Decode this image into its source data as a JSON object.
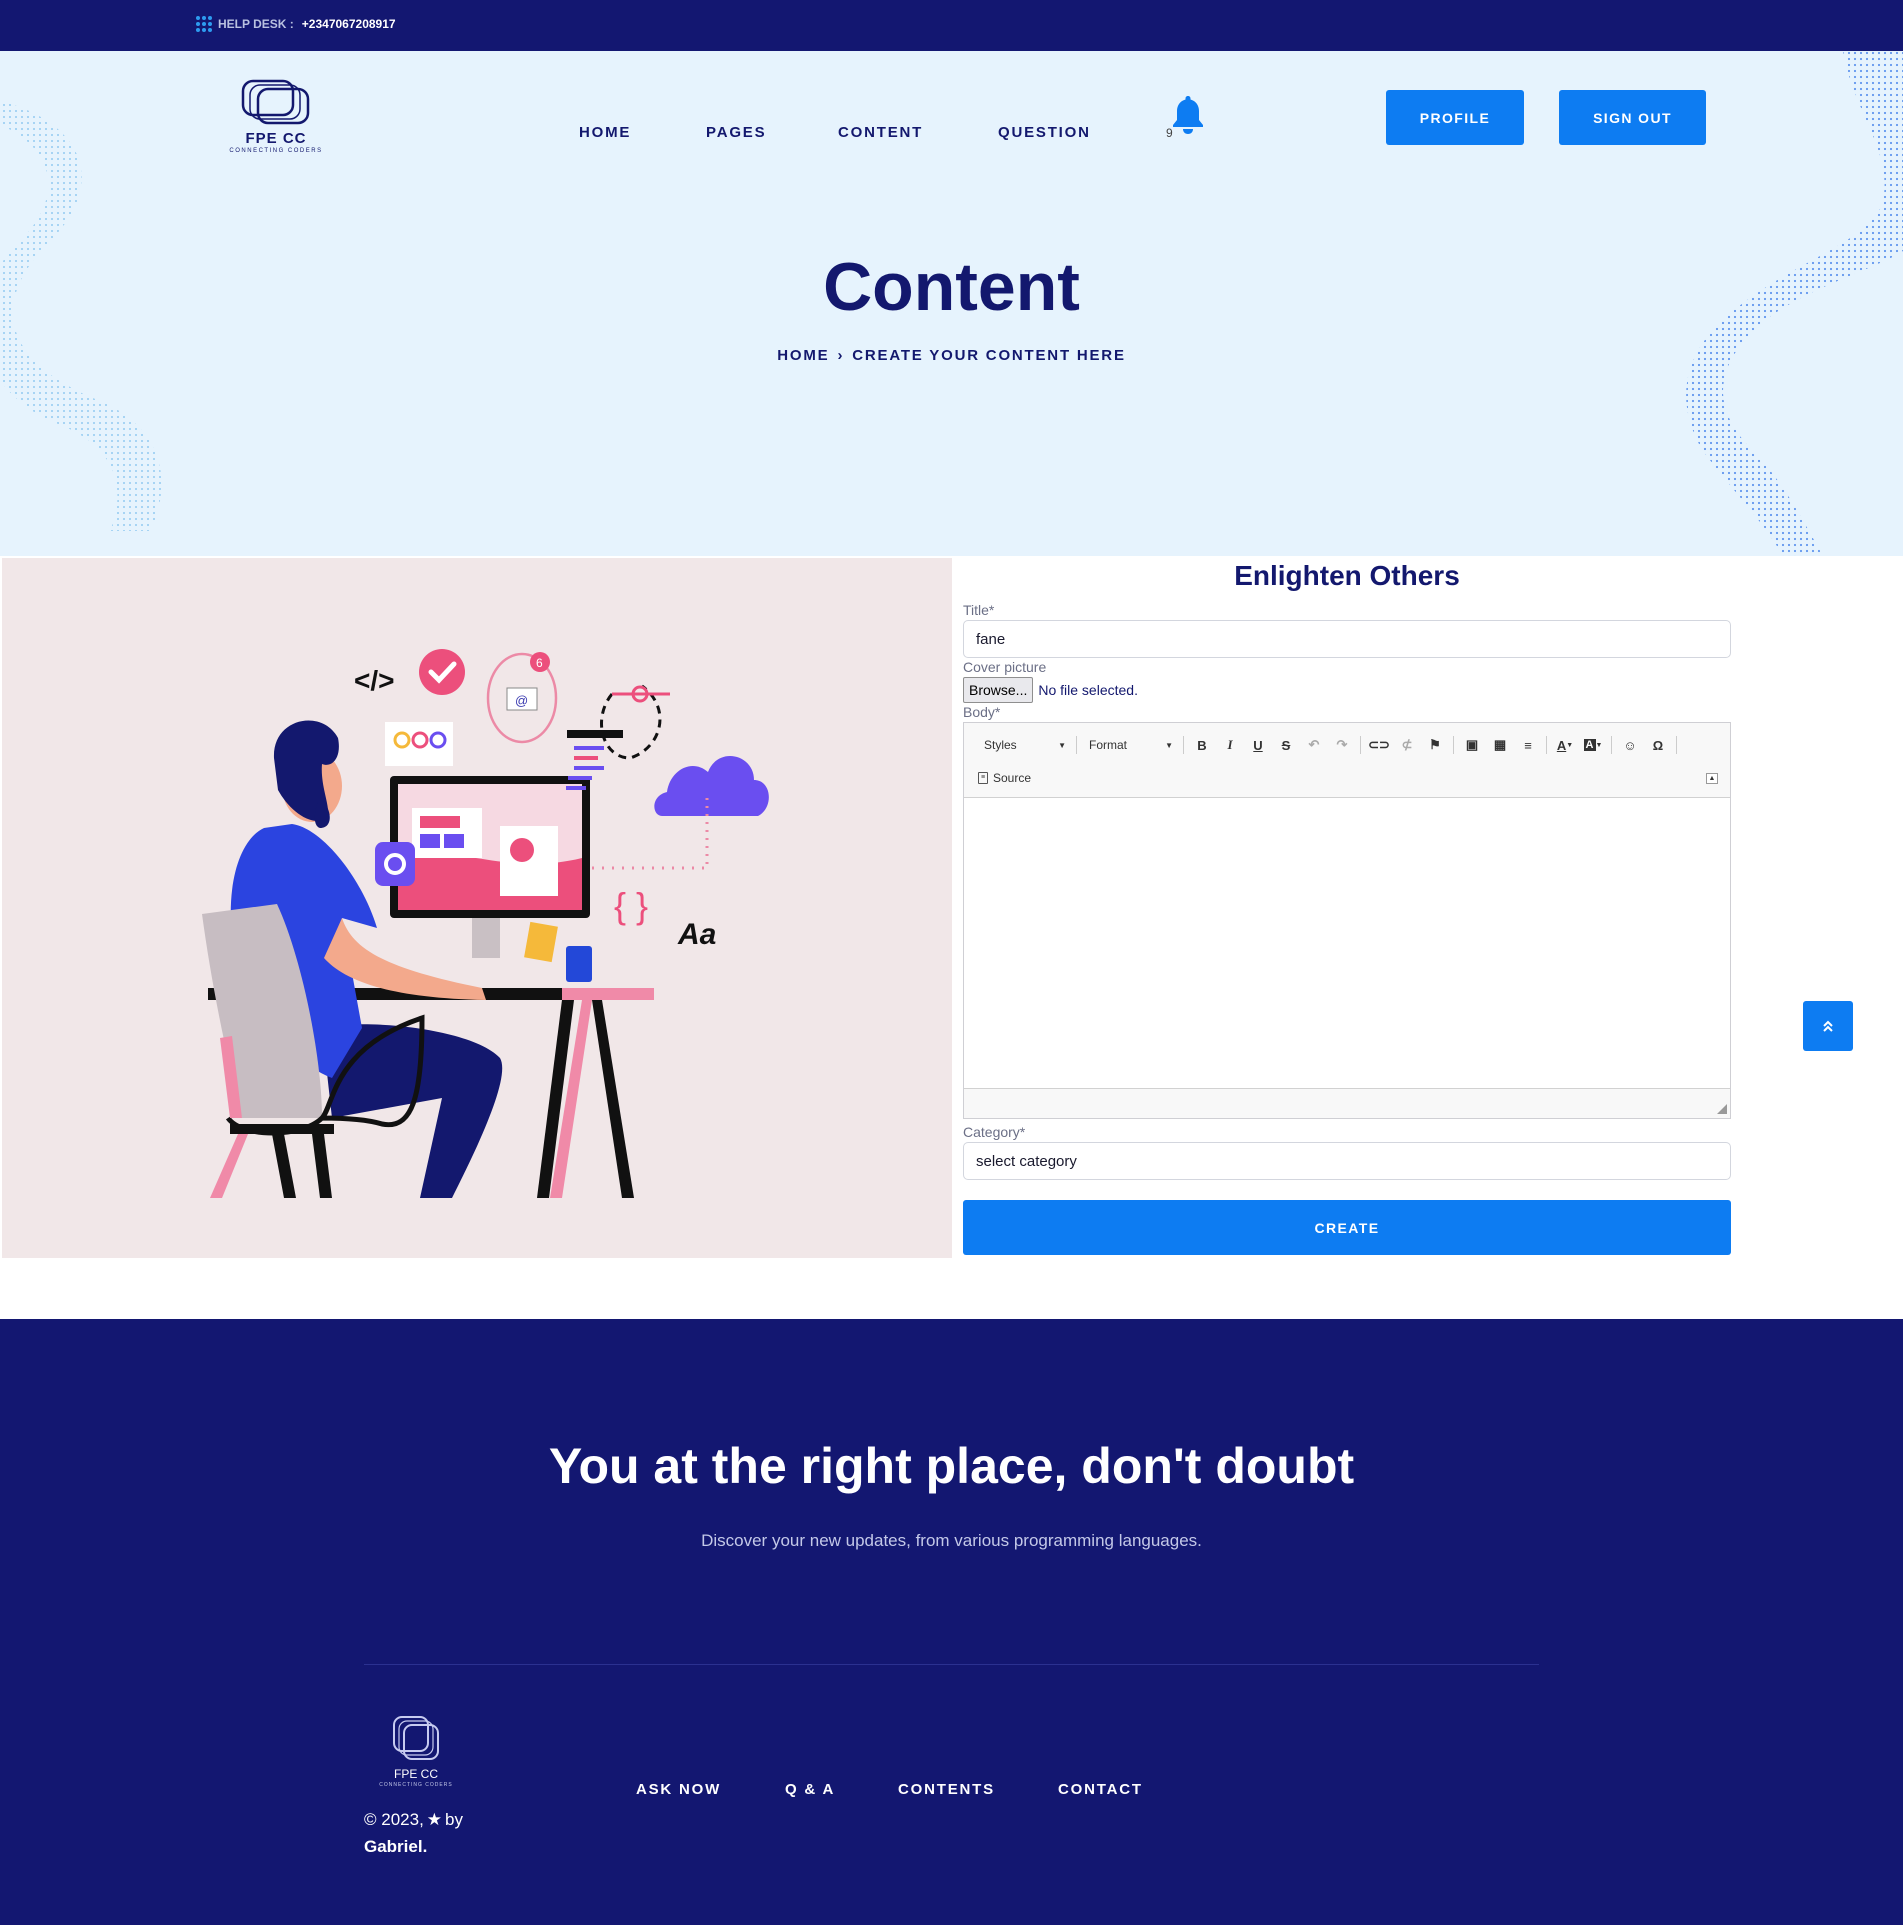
{
  "topbar": {
    "helpdesk_label": "HELP DESK :",
    "phone": "+2347067208917"
  },
  "brand": {
    "name": "FPE CC",
    "tagline": "CONNECTING CODERS"
  },
  "nav": {
    "home": "HOME",
    "pages": "PAGES",
    "content": "CONTENT",
    "question": "QUESTION"
  },
  "notifications": {
    "count": "9",
    "icon": "bell-icon"
  },
  "header_buttons": {
    "profile": "PROFILE",
    "sign_out": "SIGN OUT"
  },
  "hero": {
    "title": "Content",
    "breadcrumb_home": "HOME",
    "breadcrumb_current": "CREATE YOUR CONTENT HERE"
  },
  "form": {
    "heading": "Enlighten Others",
    "title_label": "Title*",
    "title_value": "fane",
    "cover_label": "Cover picture",
    "browse_label": "Browse...",
    "file_status": "No file selected.",
    "body_label": "Body*",
    "editor": {
      "styles": "Styles",
      "format": "Format",
      "source": "Source"
    },
    "category_label": "Category*",
    "category_value": "select category",
    "submit": "CREATE"
  },
  "footer": {
    "headline": "You at the right place, don't doubt",
    "subline": "Discover your new updates, from various programming languages.",
    "links": {
      "ask_now": "ASK NOW",
      "qa": "Q & A",
      "contents": "CONTENTS",
      "contact": "CONTACT"
    },
    "copyright_prefix": "© 2023,",
    "copyright_by": "by",
    "author": "Gabriel."
  },
  "colors": {
    "navy": "#131771",
    "accent": "#0d7cf2",
    "hero_bg": "#e6f3fd",
    "illustration_bg": "#f1e7e8"
  }
}
